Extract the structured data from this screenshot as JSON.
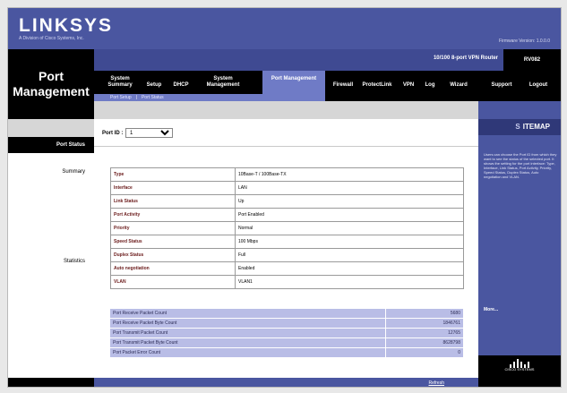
{
  "brand": {
    "logo_text": "LINKSYS",
    "subtitle": "A Division of Cisco Systems, Inc.",
    "firmware": "Firmware Version: 1.0.0.0"
  },
  "product": {
    "name": "10/100 8-port VPN Router",
    "model": "RV082"
  },
  "section_title": "Port Management",
  "main_tabs": [
    {
      "label": "System Summary",
      "active": false
    },
    {
      "label": "Setup",
      "active": false
    },
    {
      "label": "DHCP",
      "active": false
    },
    {
      "label": "System Management",
      "active": false
    },
    {
      "label": "Port Management",
      "active": true
    },
    {
      "label": "Firewall",
      "active": false
    },
    {
      "label": "ProtectLink",
      "active": false
    },
    {
      "label": "VPN",
      "active": false
    },
    {
      "label": "Log",
      "active": false
    },
    {
      "label": "Wizard",
      "active": false
    },
    {
      "label": "Support",
      "active": false
    },
    {
      "label": "Logout",
      "active": false
    }
  ],
  "sub_tabs": [
    "Port Setup",
    "Port Status"
  ],
  "sidebar": {
    "active_label": "Port Status",
    "summary_label": "Summary",
    "statistics_label": "Statistics"
  },
  "port_id": {
    "label": "Port ID :",
    "selected": "1"
  },
  "summary_rows": [
    {
      "key": "Type",
      "value": "10Base-T / 100Base-TX"
    },
    {
      "key": "Interface",
      "value": "LAN"
    },
    {
      "key": "Link Status",
      "value": "Up"
    },
    {
      "key": "Port Activity",
      "value": "Port Enabled"
    },
    {
      "key": "Priority",
      "value": "Normal"
    },
    {
      "key": "Speed Status",
      "value": "100 Mbps"
    },
    {
      "key": "Duplex Status",
      "value": "Full"
    },
    {
      "key": "Auto negotiation",
      "value": "Enabled"
    },
    {
      "key": "VLAN",
      "value": "VLAN1"
    }
  ],
  "statistics_rows": [
    {
      "label": "Port Receive Packet Count",
      "value": "5680"
    },
    {
      "label": "Port Receive Packet Byte Count",
      "value": "1846761"
    },
    {
      "label": "Port Transmit Packet Count",
      "value": "12765"
    },
    {
      "label": "Port Transmit Packet Byte Count",
      "value": "8628798"
    },
    {
      "label": "Port Packet Error Count",
      "value": "0"
    }
  ],
  "refresh_label": "Refresh",
  "sitemap": {
    "prefix": "S",
    "title": "ITEMAP",
    "text": "Users can choose the Port ID from which they want to see the status of the selected port. It shows the setting for the port interface: Type, Interface, Link Status, Port Activity, Priority, Speed Status, Duplex Status, Auto negotiation and VLAN.",
    "more_label": "More..."
  },
  "cisco": {
    "text": "CISCO SYSTEMS"
  },
  "colors": {
    "header": "#4a56a0",
    "accent": "#6f7bc6",
    "stats_bg": "#b9bde6",
    "label_text": "#6a1a1a"
  }
}
